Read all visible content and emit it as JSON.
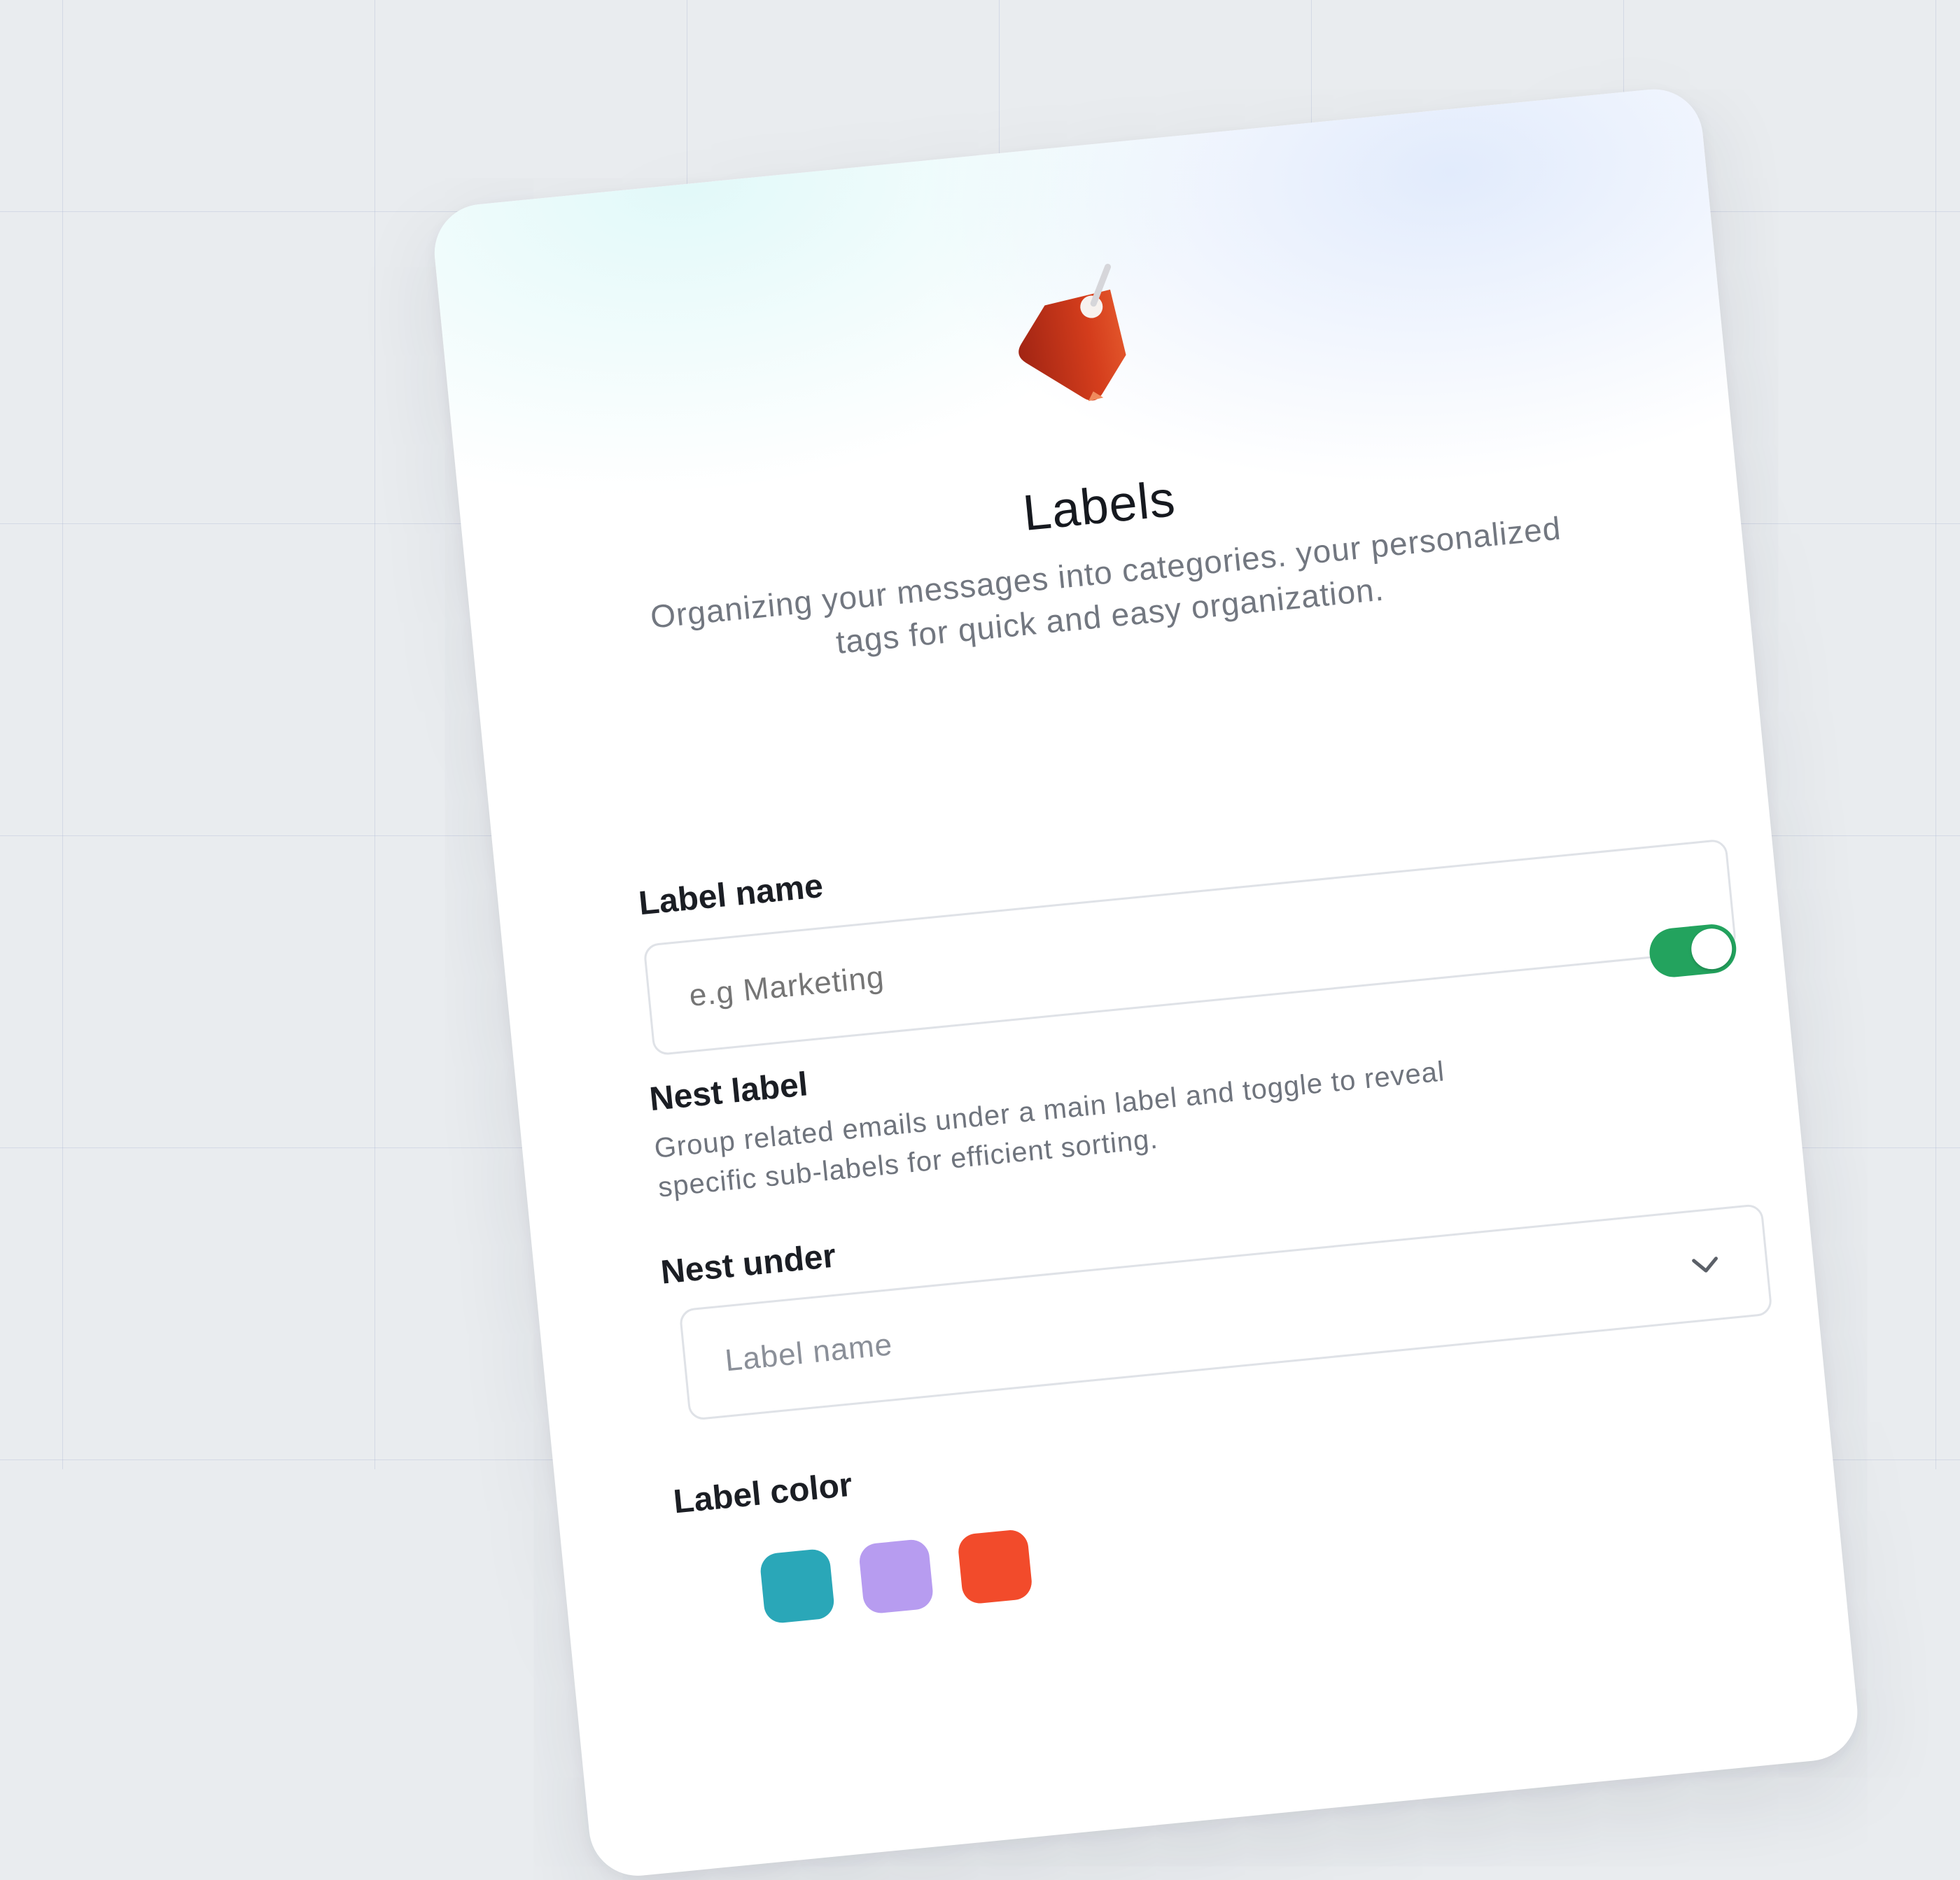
{
  "header": {
    "title": "Labels",
    "subtitle": "Organizing your messages into categories. your personalized tags for quick and easy organization.",
    "icon": "tag-icon"
  },
  "label_name": {
    "label": "Label name",
    "placeholder": "e.g Marketing"
  },
  "nest_label": {
    "label": "Nest label",
    "description": "Group related emails under a main label and toggle to reveal specific sub-labels for efficient sorting.",
    "toggle_on": true
  },
  "nest_under": {
    "label": "Nest under",
    "placeholder": "Label name",
    "icon": "chevron-down-icon"
  },
  "label_color": {
    "label": "Label color",
    "swatches": [
      "#2aa7b8",
      "#b79cf0",
      "#f24b2b"
    ]
  },
  "colors": {
    "toggle": "#23a35e",
    "tag": "#d8431e"
  }
}
